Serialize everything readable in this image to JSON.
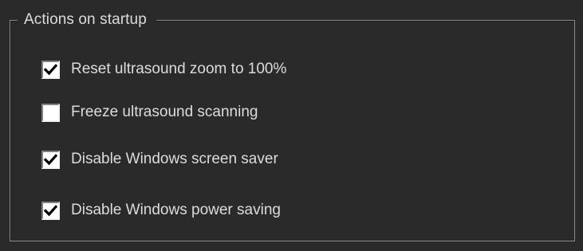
{
  "group": {
    "title": "Actions on startup"
  },
  "options": [
    {
      "label": "Reset ultrasound zoom to 100%",
      "checked": true
    },
    {
      "label": "Freeze ultrasound scanning",
      "checked": false
    },
    {
      "label": "Disable Windows screen saver",
      "checked": true
    },
    {
      "label": "Disable Windows power saving",
      "checked": true
    }
  ],
  "colors": {
    "background": "#2a2a2a",
    "text": "#dcdcdc",
    "groupbox_border": "#8a8a8a",
    "checkbox_fill": "#ffffff",
    "checkmark": "#000000"
  }
}
